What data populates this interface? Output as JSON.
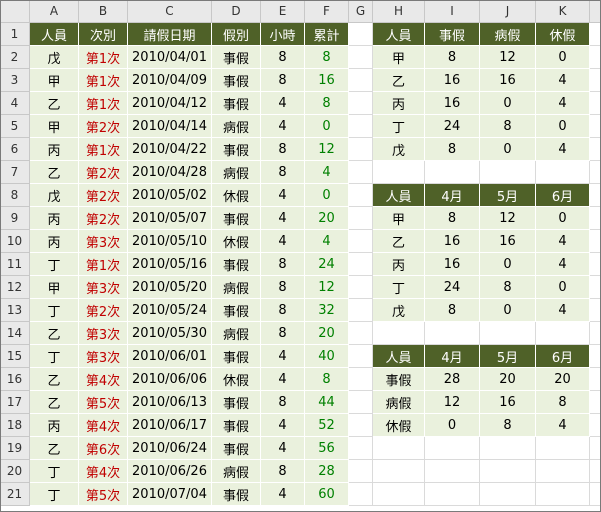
{
  "columns": [
    "A",
    "B",
    "C",
    "D",
    "E",
    "F",
    "G",
    "H",
    "I",
    "J",
    "K"
  ],
  "rows": [
    "1",
    "2",
    "3",
    "4",
    "5",
    "6",
    "7",
    "8",
    "9",
    "10",
    "11",
    "12",
    "13",
    "14",
    "15",
    "16",
    "17",
    "18",
    "19",
    "20",
    "21"
  ],
  "table1": {
    "headers": [
      "人員",
      "次別",
      "請假日期",
      "假別",
      "小時",
      "累計"
    ],
    "rows": [
      [
        "戊",
        "第1次",
        "2010/04/01",
        "事假",
        "8",
        "8"
      ],
      [
        "甲",
        "第1次",
        "2010/04/09",
        "事假",
        "8",
        "16"
      ],
      [
        "乙",
        "第1次",
        "2010/04/12",
        "事假",
        "4",
        "8"
      ],
      [
        "甲",
        "第2次",
        "2010/04/14",
        "病假",
        "4",
        "0"
      ],
      [
        "丙",
        "第1次",
        "2010/04/22",
        "事假",
        "8",
        "12"
      ],
      [
        "乙",
        "第2次",
        "2010/04/28",
        "病假",
        "8",
        "4"
      ],
      [
        "戊",
        "第2次",
        "2010/05/02",
        "休假",
        "4",
        "0"
      ],
      [
        "丙",
        "第2次",
        "2010/05/07",
        "事假",
        "4",
        "20"
      ],
      [
        "丙",
        "第3次",
        "2010/05/10",
        "休假",
        "4",
        "4"
      ],
      [
        "丁",
        "第1次",
        "2010/05/16",
        "事假",
        "8",
        "24"
      ],
      [
        "甲",
        "第3次",
        "2010/05/20",
        "病假",
        "8",
        "12"
      ],
      [
        "丁",
        "第2次",
        "2010/05/24",
        "事假",
        "8",
        "32"
      ],
      [
        "乙",
        "第3次",
        "2010/05/30",
        "病假",
        "8",
        "20"
      ],
      [
        "丁",
        "第3次",
        "2010/06/01",
        "事假",
        "4",
        "40"
      ],
      [
        "乙",
        "第4次",
        "2010/06/06",
        "休假",
        "4",
        "8"
      ],
      [
        "乙",
        "第5次",
        "2010/06/13",
        "事假",
        "8",
        "44"
      ],
      [
        "丙",
        "第4次",
        "2010/06/17",
        "事假",
        "4",
        "52"
      ],
      [
        "乙",
        "第6次",
        "2010/06/24",
        "事假",
        "4",
        "56"
      ],
      [
        "丁",
        "第4次",
        "2010/06/26",
        "病假",
        "8",
        "28"
      ],
      [
        "丁",
        "第5次",
        "2010/07/04",
        "事假",
        "4",
        "60"
      ]
    ]
  },
  "table2": {
    "headers": [
      "人員",
      "事假",
      "病假",
      "休假"
    ],
    "rows": [
      [
        "甲",
        "8",
        "12",
        "0"
      ],
      [
        "乙",
        "16",
        "16",
        "4"
      ],
      [
        "丙",
        "16",
        "0",
        "4"
      ],
      [
        "丁",
        "24",
        "8",
        "0"
      ],
      [
        "戊",
        "8",
        "0",
        "4"
      ]
    ]
  },
  "table3": {
    "headers": [
      "人員",
      "4月",
      "5月",
      "6月"
    ],
    "rows": [
      [
        "甲",
        "8",
        "12",
        "0"
      ],
      [
        "乙",
        "16",
        "16",
        "4"
      ],
      [
        "丙",
        "16",
        "0",
        "4"
      ],
      [
        "丁",
        "24",
        "8",
        "0"
      ],
      [
        "戊",
        "8",
        "0",
        "4"
      ]
    ]
  },
  "table4": {
    "headers": [
      "人員",
      "4月",
      "5月",
      "6月"
    ],
    "rows": [
      [
        "事假",
        "28",
        "20",
        "20"
      ],
      [
        "病假",
        "12",
        "16",
        "8"
      ],
      [
        "休假",
        "0",
        "8",
        "4"
      ]
    ]
  },
  "colors": {
    "header_bg": "#4f6128",
    "data_bg": "#eaf1dd",
    "red_text": "#c00000",
    "green_text": "#008000"
  }
}
